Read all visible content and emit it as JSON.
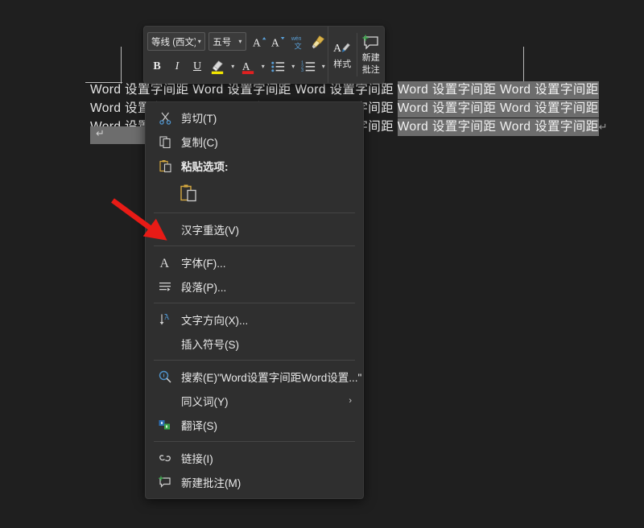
{
  "app": {
    "context": "word-document-context-menu"
  },
  "document": {
    "lines": [
      {
        "prefix": "Word 设置字间距 Word 设置字间距 Word 设置字间距 ",
        "selected": "Word 设置字间距 Word 设置字间距",
        "pilcrow": ""
      },
      {
        "prefix": "Word 设置字间距 Word 设置字间距 Word 设置字间距 ",
        "selected": "Word 设置字间距 Word 设置字间距",
        "pilcrow": ""
      },
      {
        "prefix": "Word 设置字间距 Word 设置字间距 Word 设置字间距 ",
        "selected": "Word 设置字间距 Word 设置字间距",
        "pilcrow": "↵"
      }
    ],
    "end_paragraph_mark": "↵"
  },
  "mini_toolbar": {
    "font_name": "等线 (西文)",
    "font_size": "五号",
    "grow_font_label": "A",
    "shrink_font_label": "A",
    "phonetic_guide_top": "wén",
    "phonetic_guide_bottom": "文",
    "format_painter_icon": "format-painter-icon",
    "bold_label": "B",
    "italic_label": "I",
    "underline_label": "U",
    "highlight_label": "A",
    "font_color_label": "A",
    "styles_label": "样式",
    "new_comment_line1": "新建",
    "new_comment_line2": "批注",
    "highlight_color": "#f2e600",
    "font_color": "#e02020"
  },
  "context_menu": {
    "items": [
      {
        "label": "剪切(T)",
        "icon": "cut-icon",
        "name": "menu-item-cut"
      },
      {
        "label": "复制(C)",
        "icon": "copy-icon",
        "name": "menu-item-copy"
      },
      {
        "label": "粘贴选项:",
        "icon": "paste-icon",
        "name": "menu-item-paste-options"
      },
      {
        "label": "汉字重选(V)",
        "icon": "none",
        "name": "menu-item-reselect-hanzi"
      },
      {
        "label": "字体(F)...",
        "icon": "font-icon",
        "name": "menu-item-font"
      },
      {
        "label": "段落(P)...",
        "icon": "paragraph-icon",
        "name": "menu-item-paragraph"
      },
      {
        "label": "文字方向(X)...",
        "icon": "text-direction-icon",
        "name": "menu-item-text-direction"
      },
      {
        "label": "插入符号(S)",
        "icon": "none",
        "name": "menu-item-insert-symbol"
      },
      {
        "label": "搜索(E)\"Word设置字间距Word设置...\"",
        "icon": "search-icon",
        "name": "menu-item-search"
      },
      {
        "label": "同义词(Y)",
        "icon": "none",
        "name": "menu-item-synonyms",
        "submenu": "›"
      },
      {
        "label": "翻译(S)",
        "icon": "translate-icon",
        "name": "menu-item-translate"
      },
      {
        "label": "链接(I)",
        "icon": "link-icon",
        "name": "menu-item-link"
      },
      {
        "label": "新建批注(M)",
        "icon": "new-comment-icon",
        "name": "menu-item-new-comment"
      }
    ],
    "paste_option_label": "paste-keep-source-formatting"
  },
  "annotation": {
    "arrow_color": "#e81b16",
    "points_to": "字体(F)..."
  }
}
